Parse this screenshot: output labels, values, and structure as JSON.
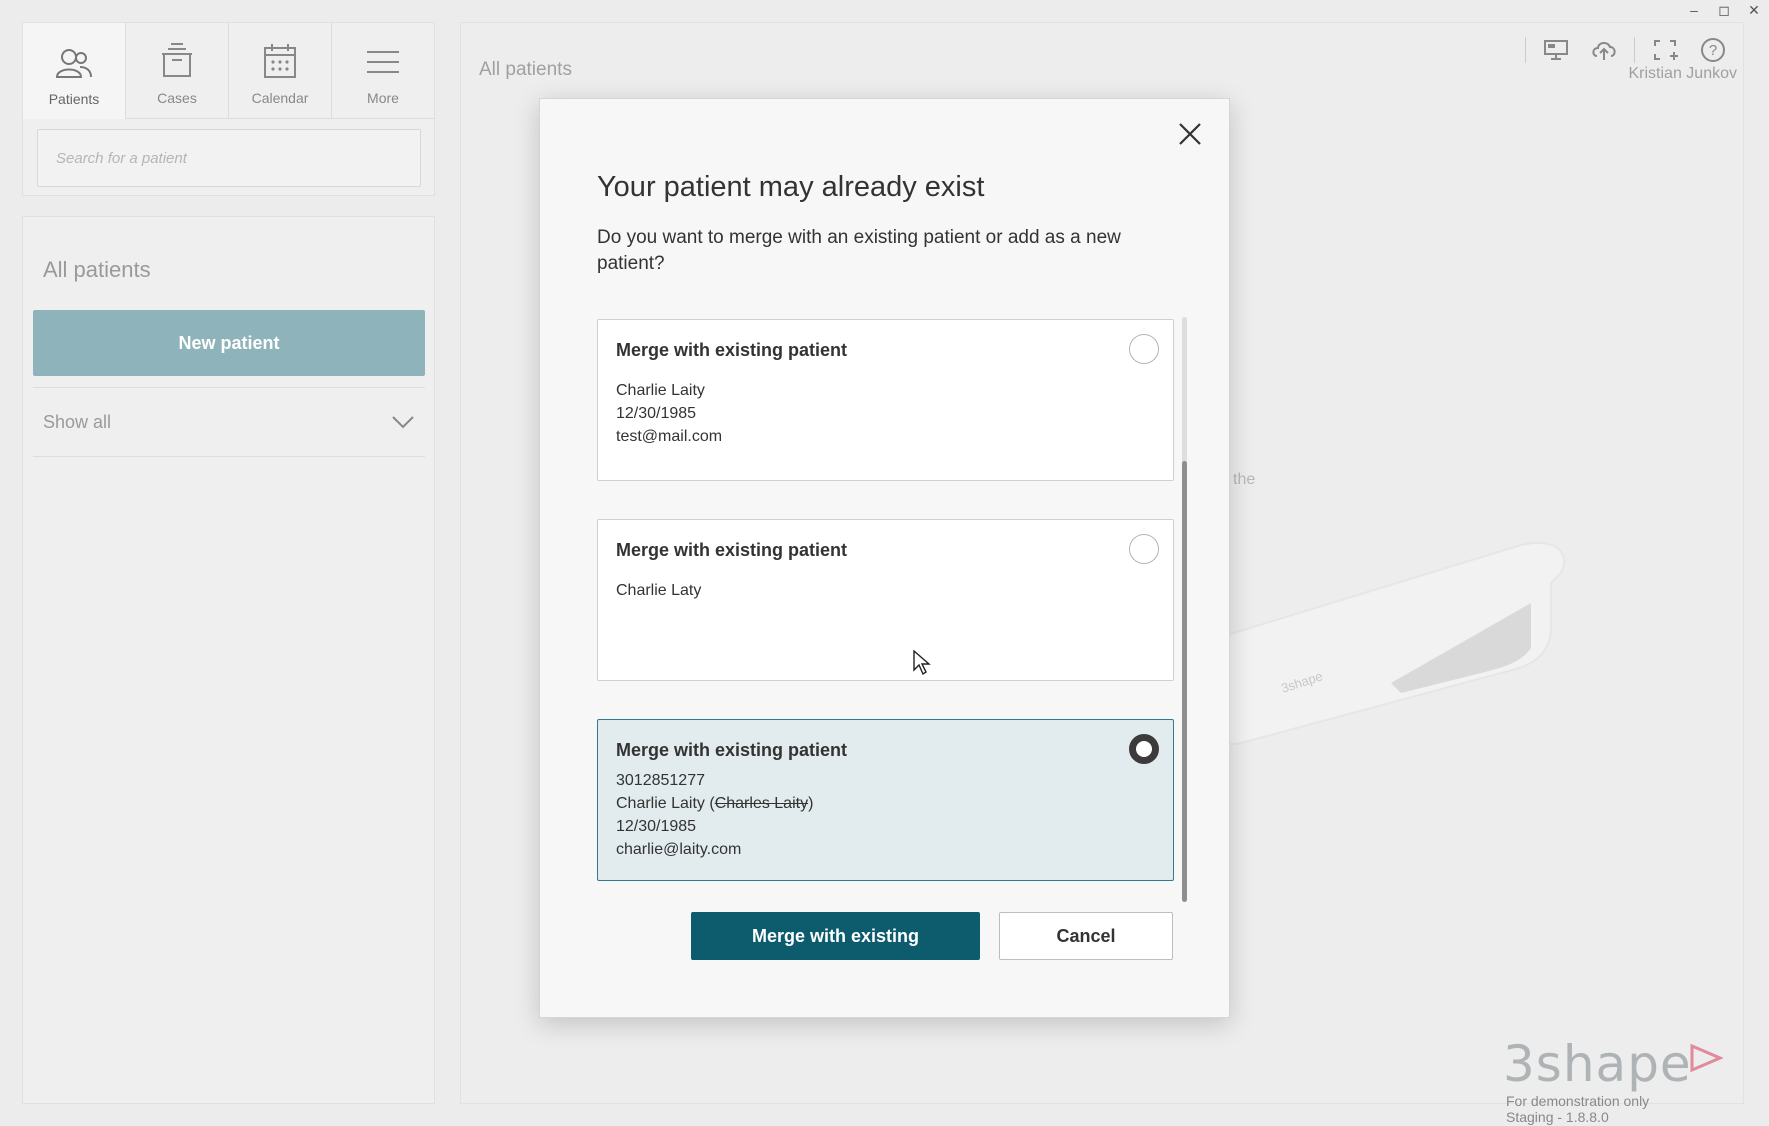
{
  "window_controls": {
    "minimize": "–",
    "maximize": "◻",
    "close": "✕"
  },
  "nav": {
    "tabs": [
      {
        "label": "Patients",
        "icon": "patients-icon",
        "active": true
      },
      {
        "label": "Cases",
        "icon": "cases-icon",
        "active": false
      },
      {
        "label": "Calendar",
        "icon": "calendar-icon",
        "active": false
      },
      {
        "label": "More",
        "icon": "menu-icon",
        "active": false
      }
    ],
    "search_placeholder": "Search for a patient"
  },
  "sidebar": {
    "title": "All patients",
    "new_patient_label": "New patient",
    "filter_label": "Show all"
  },
  "main": {
    "breadcrumb": "All patients",
    "user_name": "Kristian Junkov",
    "behind_text": "the",
    "brand": "3shape",
    "demo_line1": "For demonstration only",
    "demo_line2": "Staging - 1.8.8.0"
  },
  "dialog": {
    "title": "Your patient may already exist",
    "subtitle": "Do you want to merge with an existing patient or add as a new patient?",
    "options": [
      {
        "heading": "Merge with existing patient",
        "lines": [
          "Charlie Laity",
          "12/30/1985",
          "test@mail.com"
        ],
        "selected": false
      },
      {
        "heading": "Merge with existing patient",
        "lines": [
          "Charlie Laty"
        ],
        "selected": false
      },
      {
        "heading": "Merge with existing patient",
        "id": "3012851277",
        "name_new": "Charlie Laity (",
        "name_old": "Charles Laity",
        "name_close": ")",
        "dob": "12/30/1985",
        "email": "charlie@laity.com",
        "selected": true
      }
    ],
    "primary_button": "Merge with existing",
    "cancel_button": "Cancel"
  },
  "colors": {
    "primary": "#0d5c6e",
    "new_patient_bg": "#8fb3ba",
    "selected_bg": "#e2ecee",
    "selected_border": "#36778a"
  }
}
